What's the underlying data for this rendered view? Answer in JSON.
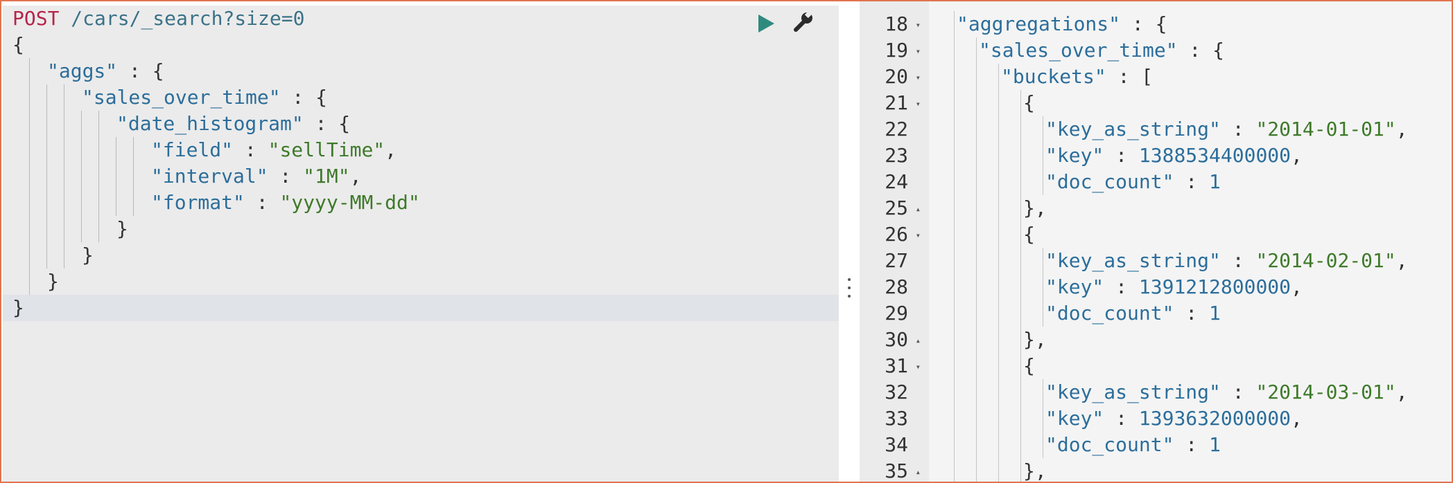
{
  "request": {
    "method": "POST",
    "url": "/cars/_search?size=0",
    "lines": [
      {
        "depth": 0,
        "tokens": [
          {
            "t": "{",
            "c": "punc"
          }
        ]
      },
      {
        "depth": 1,
        "tokens": [
          {
            "t": "\"aggs\"",
            "c": "key"
          },
          {
            "t": " : {",
            "c": "punc"
          }
        ]
      },
      {
        "depth": 2,
        "tokens": [
          {
            "t": "\"sales_over_time\"",
            "c": "key"
          },
          {
            "t": " : {",
            "c": "punc"
          }
        ]
      },
      {
        "depth": 3,
        "tokens": [
          {
            "t": "\"date_histogram\"",
            "c": "key"
          },
          {
            "t": " : {",
            "c": "punc"
          }
        ]
      },
      {
        "depth": 4,
        "tokens": [
          {
            "t": "\"field\"",
            "c": "key"
          },
          {
            "t": " : ",
            "c": "punc"
          },
          {
            "t": "\"sellTime\"",
            "c": "str"
          },
          {
            "t": ",",
            "c": "punc"
          }
        ]
      },
      {
        "depth": 4,
        "tokens": [
          {
            "t": "\"interval\"",
            "c": "key"
          },
          {
            "t": " : ",
            "c": "punc"
          },
          {
            "t": "\"1M\"",
            "c": "str"
          },
          {
            "t": ",",
            "c": "punc"
          }
        ]
      },
      {
        "depth": 4,
        "tokens": [
          {
            "t": "\"format\"",
            "c": "key"
          },
          {
            "t": " : ",
            "c": "punc"
          },
          {
            "t": "\"yyyy-MM-dd\"",
            "c": "str"
          }
        ]
      },
      {
        "depth": 3,
        "tokens": [
          {
            "t": "}",
            "c": "punc"
          }
        ]
      },
      {
        "depth": 2,
        "tokens": [
          {
            "t": "}",
            "c": "punc"
          }
        ]
      },
      {
        "depth": 1,
        "tokens": [
          {
            "t": "}",
            "c": "punc"
          }
        ]
      },
      {
        "depth": 0,
        "tokens": [
          {
            "t": "}",
            "c": "punc"
          }
        ],
        "active": true
      }
    ]
  },
  "toolbar": {
    "run_icon": "play-icon",
    "settings_icon": "wrench-icon",
    "accent_color": "#2f8a7e"
  },
  "response": {
    "lines": [
      {
        "num": "18",
        "fold": "down",
        "depth": 1,
        "tokens": [
          {
            "t": "\"aggregations\"",
            "c": "key"
          },
          {
            "t": " : {",
            "c": "punc"
          }
        ]
      },
      {
        "num": "19",
        "fold": "down",
        "depth": 2,
        "tokens": [
          {
            "t": "\"sales_over_time\"",
            "c": "key"
          },
          {
            "t": " : {",
            "c": "punc"
          }
        ]
      },
      {
        "num": "20",
        "fold": "down",
        "depth": 3,
        "tokens": [
          {
            "t": "\"buckets\"",
            "c": "key"
          },
          {
            "t": " : [",
            "c": "punc"
          }
        ]
      },
      {
        "num": "21",
        "fold": "down",
        "depth": 4,
        "tokens": [
          {
            "t": "{",
            "c": "punc"
          }
        ]
      },
      {
        "num": "22",
        "fold": "",
        "depth": 5,
        "tokens": [
          {
            "t": "\"key_as_string\"",
            "c": "key"
          },
          {
            "t": " : ",
            "c": "punc"
          },
          {
            "t": "\"2014-01-01\"",
            "c": "str"
          },
          {
            "t": ",",
            "c": "punc"
          }
        ]
      },
      {
        "num": "23",
        "fold": "",
        "depth": 5,
        "tokens": [
          {
            "t": "\"key\"",
            "c": "key"
          },
          {
            "t": " : ",
            "c": "punc"
          },
          {
            "t": "1388534400000",
            "c": "num"
          },
          {
            "t": ",",
            "c": "punc"
          }
        ]
      },
      {
        "num": "24",
        "fold": "",
        "depth": 5,
        "tokens": [
          {
            "t": "\"doc_count\"",
            "c": "key"
          },
          {
            "t": " : ",
            "c": "punc"
          },
          {
            "t": "1",
            "c": "num"
          }
        ]
      },
      {
        "num": "25",
        "fold": "up",
        "depth": 4,
        "tokens": [
          {
            "t": "},",
            "c": "punc"
          }
        ]
      },
      {
        "num": "26",
        "fold": "down",
        "depth": 4,
        "tokens": [
          {
            "t": "{",
            "c": "punc"
          }
        ]
      },
      {
        "num": "27",
        "fold": "",
        "depth": 5,
        "tokens": [
          {
            "t": "\"key_as_string\"",
            "c": "key"
          },
          {
            "t": " : ",
            "c": "punc"
          },
          {
            "t": "\"2014-02-01\"",
            "c": "str"
          },
          {
            "t": ",",
            "c": "punc"
          }
        ]
      },
      {
        "num": "28",
        "fold": "",
        "depth": 5,
        "tokens": [
          {
            "t": "\"key\"",
            "c": "key"
          },
          {
            "t": " : ",
            "c": "punc"
          },
          {
            "t": "1391212800000",
            "c": "num"
          },
          {
            "t": ",",
            "c": "punc"
          }
        ]
      },
      {
        "num": "29",
        "fold": "",
        "depth": 5,
        "tokens": [
          {
            "t": "\"doc_count\"",
            "c": "key"
          },
          {
            "t": " : ",
            "c": "punc"
          },
          {
            "t": "1",
            "c": "num"
          }
        ]
      },
      {
        "num": "30",
        "fold": "up",
        "depth": 4,
        "tokens": [
          {
            "t": "},",
            "c": "punc"
          }
        ]
      },
      {
        "num": "31",
        "fold": "down",
        "depth": 4,
        "tokens": [
          {
            "t": "{",
            "c": "punc"
          }
        ]
      },
      {
        "num": "32",
        "fold": "",
        "depth": 5,
        "tokens": [
          {
            "t": "\"key_as_string\"",
            "c": "key"
          },
          {
            "t": " : ",
            "c": "punc"
          },
          {
            "t": "\"2014-03-01\"",
            "c": "str"
          },
          {
            "t": ",",
            "c": "punc"
          }
        ]
      },
      {
        "num": "33",
        "fold": "",
        "depth": 5,
        "tokens": [
          {
            "t": "\"key\"",
            "c": "key"
          },
          {
            "t": " : ",
            "c": "punc"
          },
          {
            "t": "1393632000000",
            "c": "num"
          },
          {
            "t": ",",
            "c": "punc"
          }
        ]
      },
      {
        "num": "34",
        "fold": "",
        "depth": 5,
        "tokens": [
          {
            "t": "\"doc_count\"",
            "c": "key"
          },
          {
            "t": " : ",
            "c": "punc"
          },
          {
            "t": "1",
            "c": "num"
          }
        ]
      },
      {
        "num": "35",
        "fold": "up",
        "depth": 4,
        "tokens": [
          {
            "t": "},",
            "c": "punc"
          }
        ]
      }
    ]
  }
}
